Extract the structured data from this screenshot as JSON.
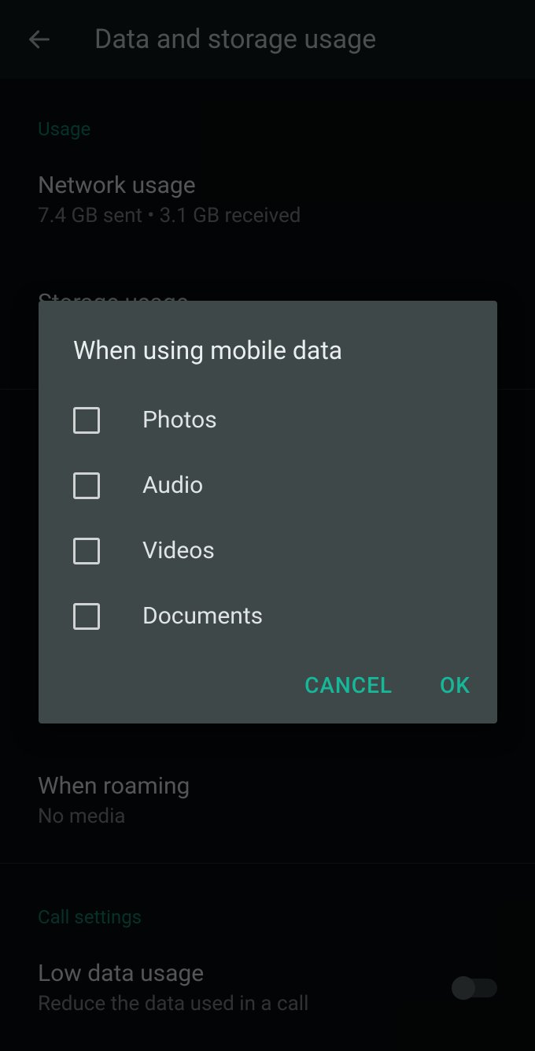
{
  "header": {
    "title": "Data and storage usage"
  },
  "sections": {
    "usage": {
      "header": "Usage",
      "network": {
        "title": "Network usage",
        "sub": "7.4 GB sent • 3.1 GB received"
      },
      "storage": {
        "title": "Storage usage"
      }
    },
    "roaming": {
      "title": "When roaming",
      "sub": "No media"
    },
    "call": {
      "header": "Call settings",
      "low": {
        "title": "Low data usage",
        "sub": "Reduce the data used in a call"
      }
    }
  },
  "dialog": {
    "title": "When using mobile data",
    "options": [
      {
        "label": "Photos",
        "checked": false
      },
      {
        "label": "Audio",
        "checked": false
      },
      {
        "label": "Videos",
        "checked": false
      },
      {
        "label": "Documents",
        "checked": false
      }
    ],
    "cancel": "CANCEL",
    "ok": "OK"
  },
  "colors": {
    "accent": "#16b89a",
    "section_header": "#0e6e5b",
    "dialog_bg": "#3f4849"
  }
}
